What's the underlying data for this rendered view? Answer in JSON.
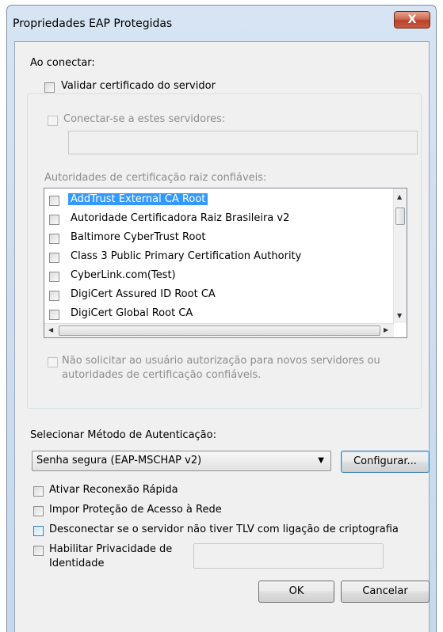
{
  "window": {
    "title": "Propriedades EAP Protegidas",
    "close_label": "X"
  },
  "connect": {
    "heading": "Ao conectar:",
    "validate_cert_label": "Validar certificado do servidor",
    "connect_servers_label": "Conectar-se a estes servidores:",
    "servers_value": "",
    "trusted_ca_heading": "Autoridades de certificação raiz confiáveis:",
    "ca_list": [
      {
        "label": "AddTrust External CA Root",
        "checked": false,
        "selected": true
      },
      {
        "label": "Autoridade Certificadora Raiz Brasileira v2",
        "checked": false,
        "selected": false
      },
      {
        "label": "Baltimore CyberTrust Root",
        "checked": false,
        "selected": false
      },
      {
        "label": "Class 3 Public Primary Certification Authority",
        "checked": false,
        "selected": false
      },
      {
        "label": "CyberLink.com(Test)",
        "checked": false,
        "selected": false
      },
      {
        "label": "DigiCert Assured ID Root CA",
        "checked": false,
        "selected": false
      },
      {
        "label": "DigiCert Global Root CA",
        "checked": false,
        "selected": false
      }
    ],
    "no_prompt_label_line1": "Não solicitar ao usuário autorização para novos servidores ou",
    "no_prompt_label_line2": "autoridades de certificação confiáveis."
  },
  "auth": {
    "heading": "Selecionar Método de Autenticação:",
    "method_value": "Senha segura (EAP-MSCHAP v2)",
    "configure_label": "Configurar..."
  },
  "options": {
    "fast_reconnect_label": "Ativar Reconexão Rápida",
    "nap_label": "Impor Proteção de Acesso à Rede",
    "tlv_label": "Desconectar se o servidor não tiver TLV com ligação de criptografia",
    "identity_privacy_line1": "Habilitar Privacidade de",
    "identity_privacy_line2": "Identidade",
    "identity_value": ""
  },
  "buttons": {
    "ok": "OK",
    "cancel": "Cancelar"
  },
  "colors": {
    "selection": "#3399ff",
    "frame": "#c6d8ec",
    "close": "#c95a3f"
  }
}
